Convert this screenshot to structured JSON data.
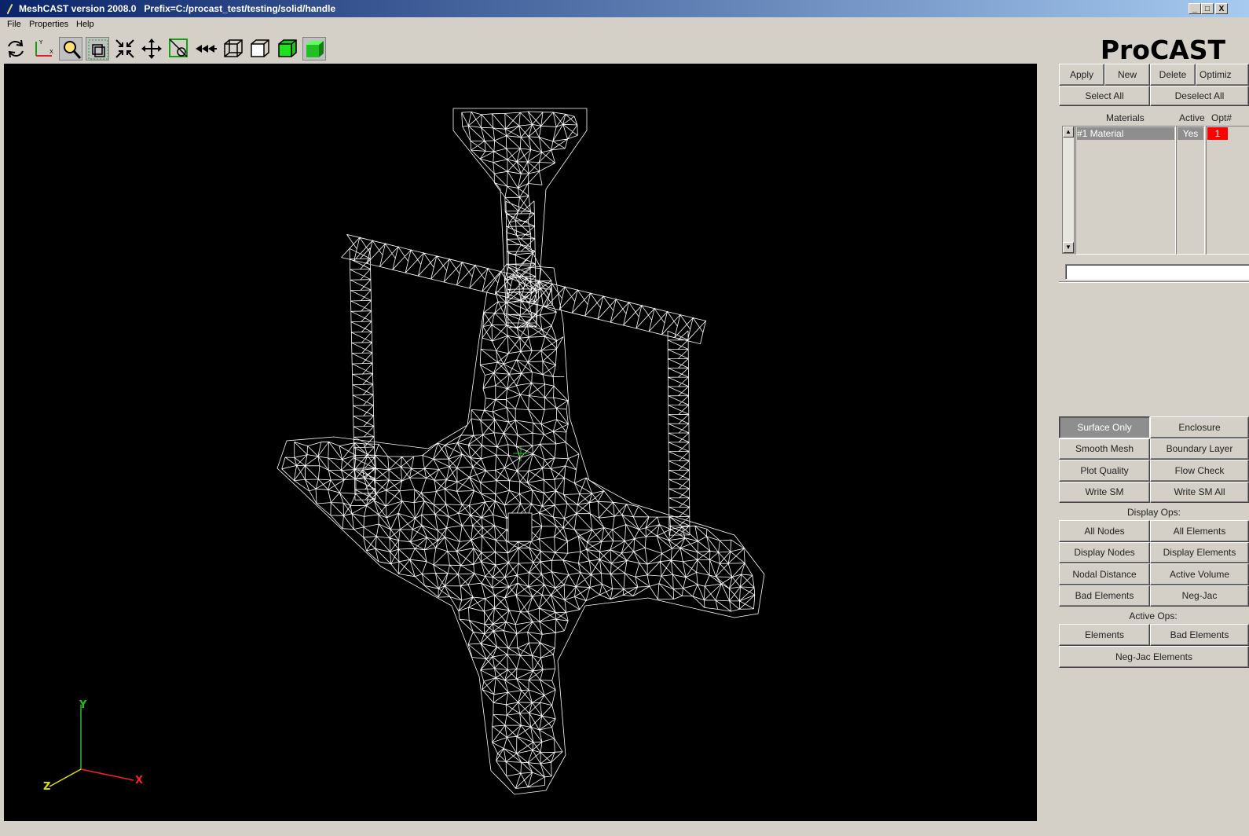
{
  "window": {
    "title": "MeshCAST version 2008.0   Prefix=C:/procast_test/testing/solid/handle",
    "controls": [
      "_",
      "□",
      "X"
    ]
  },
  "menubar": {
    "items": [
      "File",
      "Properties",
      "Help"
    ]
  },
  "toolbar": {
    "icons": [
      "rotate-icon",
      "axes-icon",
      "zoom-icon",
      "zoom-window-icon",
      "fit-icon",
      "pan-icon",
      "pick-icon",
      "reset-view-icon",
      "wireframe-icon",
      "hidden-line-icon",
      "shaded-icon",
      "solid-icon"
    ]
  },
  "logo": "ProCAST",
  "panel": {
    "top_buttons": [
      "Apply",
      "New",
      "Delete",
      "Optimiz"
    ],
    "select_all": "Select All",
    "deselect_all": "Deselect All",
    "materials_header": "Materials",
    "active_header": "Active",
    "opt_header": "Opt#",
    "material_name": "#1 Material",
    "material_active": "Yes",
    "material_opt": "1",
    "material_opt_color": "#ff0000",
    "textbox_value": "",
    "ops": {
      "surface_only": "Surface Only",
      "enclosure": "Enclosure",
      "smooth_mesh": "Smooth Mesh",
      "boundary_layer": "Boundary Layer",
      "plot_quality": "Plot Quality",
      "flow_check": "Flow Check",
      "write_sm": "Write SM",
      "write_sm_all": "Write SM All"
    },
    "display_ops_label": "Display Ops:",
    "display_ops": {
      "all_nodes": "All Nodes",
      "all_elements": "All Elements",
      "display_nodes": "Display Nodes",
      "display_elements": "Display Elements",
      "nodal_distance": "Nodal Distance",
      "active_volume": "Active Volume",
      "bad_elements": "Bad Elements",
      "neg_jac": "Neg-Jac"
    },
    "active_ops_label": "Active Ops:",
    "active_ops": {
      "elements": "Elements",
      "bad_elements": "Bad Elements",
      "neg_jac_elements": "Neg-Jac Elements"
    }
  },
  "triad": {
    "x": "X",
    "y": "Y",
    "z": "Z",
    "x_color": "#ff2020",
    "y_color": "#20c020",
    "z_color": "#e0e000"
  },
  "colors": {
    "mesh": "#ffffff",
    "viewport_bg": "#000000",
    "selected": "#8e8e8e"
  }
}
